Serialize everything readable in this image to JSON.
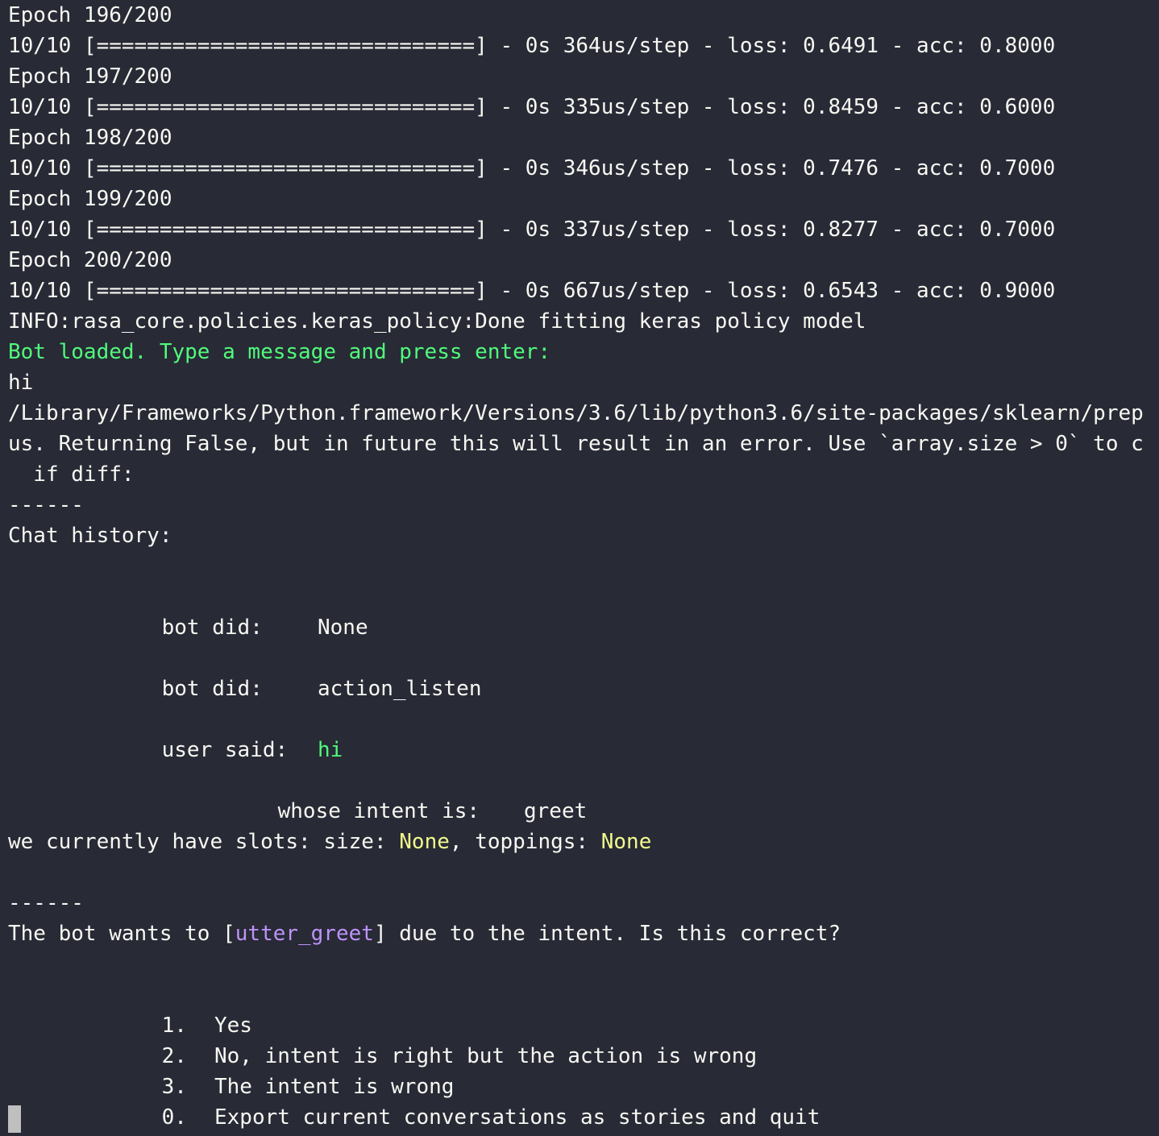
{
  "epochs": [
    {
      "epoch": "Epoch 196/200",
      "progress": "10/10 [==============================] - 0s 364us/step - loss: 0.6491 - acc: 0.8000"
    },
    {
      "epoch": "Epoch 197/200",
      "progress": "10/10 [==============================] - 0s 335us/step - loss: 0.8459 - acc: 0.6000"
    },
    {
      "epoch": "Epoch 198/200",
      "progress": "10/10 [==============================] - 0s 346us/step - loss: 0.7476 - acc: 0.7000"
    },
    {
      "epoch": "Epoch 199/200",
      "progress": "10/10 [==============================] - 0s 337us/step - loss: 0.8277 - acc: 0.7000"
    },
    {
      "epoch": "Epoch 200/200",
      "progress": "10/10 [==============================] - 0s 667us/step - loss: 0.6543 - acc: 0.9000"
    }
  ],
  "info_line": "INFO:rasa_core.policies.keras_policy:Done fitting keras policy model",
  "bot_loaded": "Bot loaded. Type a message and press enter:",
  "user_input": "hi",
  "warning": {
    "line1": "/Library/Frameworks/Python.framework/Versions/3.6/lib/python3.6/site-packages/sklearn/prep",
    "line2": "us. Returning False, but in future this will result in an error. Use `array.size > 0` to c",
    "line3": "  if diff:"
  },
  "separator": "------",
  "chat_history_label": "Chat history:",
  "history": {
    "bot_did_label": "bot did:",
    "bot_did_1": "None",
    "bot_did_2": "action_listen",
    "user_said_label": "user said:",
    "user_said": "hi",
    "intent_label": "whose intent is:",
    "intent": "greet"
  },
  "slots": {
    "prefix": "we currently have slots: size: ",
    "size": "None",
    "sep": ", toppings: ",
    "toppings": "None"
  },
  "question": {
    "prefix": "The bot wants to [",
    "action": "utter_greet",
    "suffix": "] due to the intent. Is this correct?"
  },
  "options": [
    {
      "num": "1.",
      "label": "Yes"
    },
    {
      "num": "2.",
      "label": "No, intent is right but the action is wrong"
    },
    {
      "num": "3.",
      "label": "The intent is wrong"
    },
    {
      "num": "0.",
      "label": "Export current conversations as stories and quit"
    }
  ],
  "colors": {
    "background": "#282a36",
    "foreground": "#f8f8f2",
    "green": "#50fa7b",
    "yellow": "#f1fa8c",
    "purple": "#bd93f9"
  }
}
